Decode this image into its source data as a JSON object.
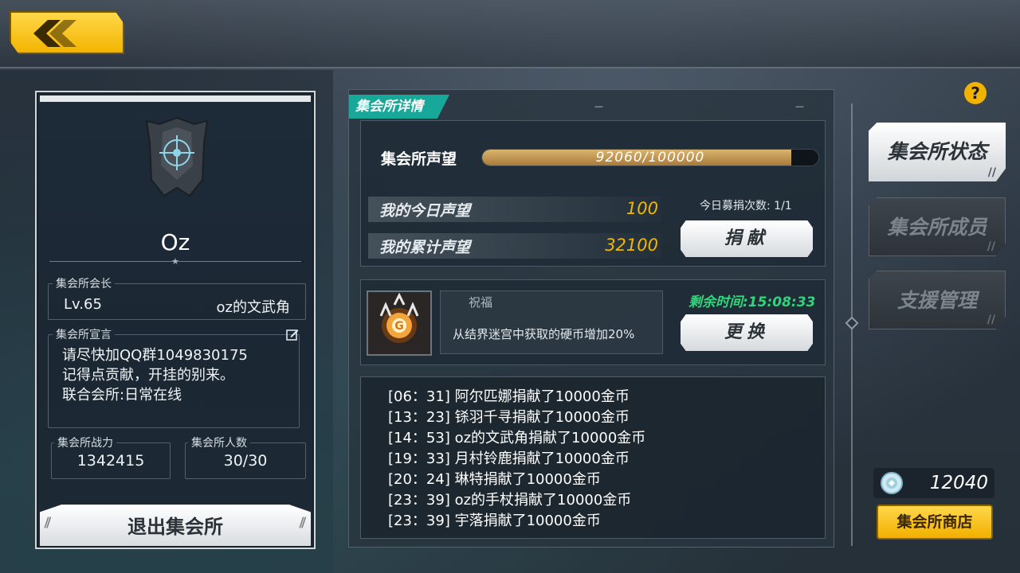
{
  "guild": {
    "name": "Oz",
    "leader_label": "集会所会长",
    "leader_level": "Lv.65",
    "leader_name": "oz的文武角",
    "declaration_label": "集会所宣言",
    "declaration": "请尽快加QQ群1049830175\n记得点贡献，开挂的别来。\n联合会所:日常在线",
    "power_label": "集会所战力",
    "power_value": "1342415",
    "members_label": "集会所人数",
    "members_value": "30/30",
    "exit_label": "退出集会所"
  },
  "detail": {
    "tab_label": "集会所详情",
    "reputation_label": "集会所声望",
    "reputation_text": "92060/100000",
    "reputation_progress": 0.9206,
    "today_label": "我的今日声望",
    "today_value": "100",
    "total_label": "我的累计声望",
    "total_value": "32100",
    "donate_count": "今日募捐次数: 1/1",
    "donate_label": "捐献",
    "blessing_title": "祝福",
    "blessing_desc": "从结界迷宫中获取的硬币增加20%",
    "remaining_time": "剩余时间:15:08:33",
    "change_label": "更换"
  },
  "logs": [
    "[06：31] 阿尔匹娜捐献了10000金币",
    "[13：23] 铩羽千寻捐献了10000金币",
    "[14：53] oz的文武角捐献了10000金币",
    "[19：33] 月村铃鹿捐献了10000金币",
    "[20：24] 琳特捐献了10000金币",
    "[23：39] oz的手杖捐献了10000金币",
    "[23：39] 宇落捐献了10000金币"
  ],
  "sidebar": {
    "status_label": "集会所状态",
    "members_label": "集会所成员",
    "support_label": "支援管理"
  },
  "currency": {
    "value": "12040",
    "icon": "guild-coin-icon"
  },
  "shop_label": "集会所商店",
  "colors": {
    "accent_gold": "#f2b400",
    "tab_teal": "#18a89a",
    "value_gold": "#f0b800",
    "timer_green": "#2fd67a"
  }
}
